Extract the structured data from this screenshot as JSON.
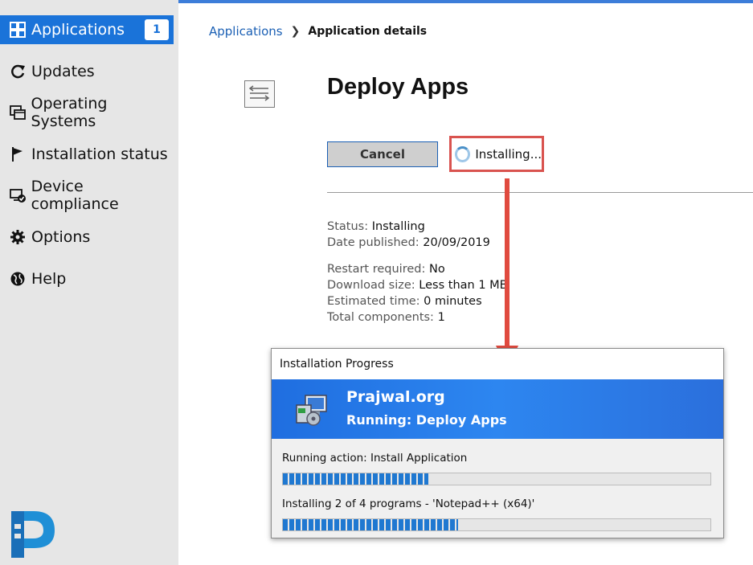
{
  "sidebar": {
    "items": [
      {
        "label": "Applications",
        "icon": "grid-icon",
        "badge": "1",
        "active": true
      },
      {
        "label": "Updates",
        "icon": "refresh-icon"
      },
      {
        "label": "Operating Systems",
        "icon": "windows-stack-icon"
      },
      {
        "label": "Installation status",
        "icon": "flag-icon"
      },
      {
        "label": "Device compliance",
        "icon": "device-check-icon"
      },
      {
        "label": "Options",
        "icon": "gear-icon"
      },
      {
        "label": "Help",
        "icon": "globe-icon"
      }
    ]
  },
  "breadcrumb": {
    "parent": "Applications",
    "separator": "❯",
    "current": "Application details"
  },
  "app": {
    "title": "Deploy Apps",
    "icon": "application-icon",
    "cancel_label": "Cancel",
    "installing_label": "Installing..."
  },
  "details": {
    "status_label": "Status:",
    "status_value": "Installing",
    "published_label": "Date published:",
    "published_value": "20/09/2019",
    "restart_label": "Restart required:",
    "restart_value": "No",
    "download_label": "Download size:",
    "download_value": "Less than 1 MB",
    "time_label": "Estimated time:",
    "time_value": "0 minutes",
    "components_label": "Total components:",
    "components_value": "1"
  },
  "dialog": {
    "title": "Installation Progress",
    "org": "Prajwal.org",
    "running": "Running: Deploy Apps",
    "action": "Running action: Install Application",
    "action_progress": 0.34,
    "status": "Installing 2 of 4 programs - 'Notepad++ (x64)'",
    "status_progress": 0.41
  },
  "colors": {
    "accent": "#1a73d9",
    "highlight_border": "#d9534f",
    "arrow": "#e04a3f",
    "banner": "#2d86f0"
  }
}
